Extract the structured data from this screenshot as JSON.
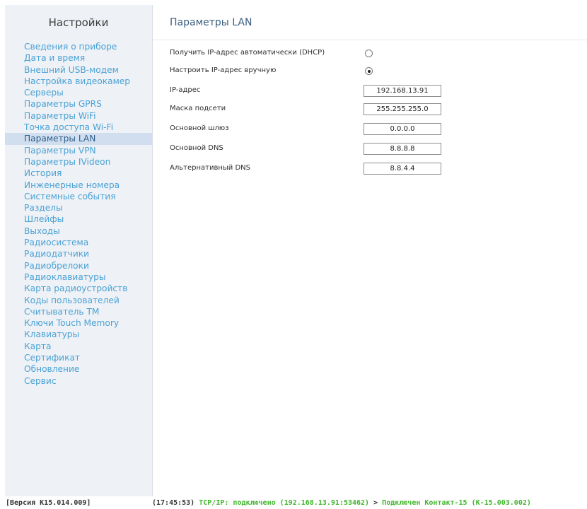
{
  "sidebar": {
    "title": "Настройки",
    "items": [
      {
        "label": "Сведения о приборе"
      },
      {
        "label": "Дата и время"
      },
      {
        "label": "Внешний USB-модем"
      },
      {
        "label": "Настройка видеокамер"
      },
      {
        "label": "Серверы"
      },
      {
        "label": "Параметры GPRS"
      },
      {
        "label": "Параметры WiFi"
      },
      {
        "label": "Точка доступа Wi-Fi"
      },
      {
        "label": "Параметры LAN",
        "active": true
      },
      {
        "label": "Параметры VPN"
      },
      {
        "label": "Параметры IVideon"
      },
      {
        "label": "История"
      },
      {
        "label": "Инженерные номера"
      },
      {
        "label": "Системные события"
      },
      {
        "label": "Разделы"
      },
      {
        "label": "Шлейфы"
      },
      {
        "label": "Выходы"
      },
      {
        "label": "Радиосистема"
      },
      {
        "label": "Радиодатчики"
      },
      {
        "label": "Радиобрелоки"
      },
      {
        "label": "Радиоклавиатуры"
      },
      {
        "label": "Карта радиоустройств"
      },
      {
        "label": "Коды пользователей"
      },
      {
        "label": "Считыватель ТМ"
      },
      {
        "label": "Ключи Touch Memory"
      },
      {
        "label": "Клавиатуры"
      },
      {
        "label": "Карта"
      },
      {
        "label": "Сертификат"
      },
      {
        "label": "Обновление"
      },
      {
        "label": "Сервис"
      }
    ]
  },
  "main": {
    "title": "Параметры LAN",
    "dhcp": {
      "label": "Получить IP-адрес автоматически (DHCP)",
      "selected": false
    },
    "manual": {
      "label": "Настроить IP-адрес вручную",
      "selected": true
    },
    "ip": {
      "label": "IP-адрес",
      "value": "192.168.13.91"
    },
    "mask": {
      "label": "Маска подсети",
      "value": "255.255.255.0"
    },
    "gateway": {
      "label": "Основной шлюз",
      "value": "0.0.0.0"
    },
    "dns1": {
      "label": "Основной DNS",
      "value": "8.8.8.8"
    },
    "dns2": {
      "label": "Альтернативный DNS",
      "value": "8.8.4.4"
    }
  },
  "status": {
    "version": "[Версия К15.014.009]",
    "time": "(17:45:53)",
    "tcp": "TCP/IP: подключено (192.168.13.91:53462)",
    "arrow": ">",
    "device": "Подключен Контакт-15 (К-15.003.002)"
  },
  "colors": {
    "link": "#4aa2d6",
    "active_bg": "#d0def0",
    "status_ok": "#3fb52a"
  }
}
